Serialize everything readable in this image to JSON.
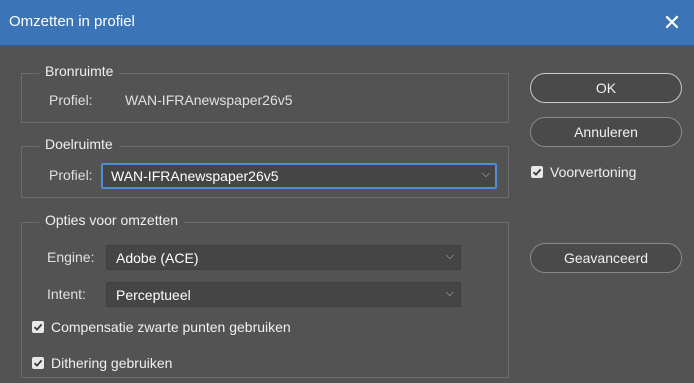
{
  "window": {
    "title": "Omzetten in profiel",
    "close_icon": "close-icon"
  },
  "source": {
    "legend": "Bronruimte",
    "profile_label": "Profiel:",
    "profile_value": "WAN-IFRAnewspaper26v5"
  },
  "destination": {
    "legend": "Doelruimte",
    "profile_label": "Profiel:",
    "profile_value": "WAN-IFRAnewspaper26v5"
  },
  "options": {
    "legend": "Opties voor omzetten",
    "engine_label": "Engine:",
    "engine_value": "Adobe (ACE)",
    "intent_label": "Intent:",
    "intent_value": "Perceptueel",
    "black_point_label": "Compensatie zwarte punten gebruiken",
    "black_point_checked": true,
    "dither_label": "Dithering gebruiken",
    "dither_checked": true
  },
  "buttons": {
    "ok": "OK",
    "cancel": "Annuleren",
    "advanced": "Geavanceerd"
  },
  "preview": {
    "label": "Voorvertoning",
    "checked": true
  },
  "colors": {
    "titlebar": "#3b74b7",
    "background": "#535353",
    "focus": "#4f8fd8"
  }
}
